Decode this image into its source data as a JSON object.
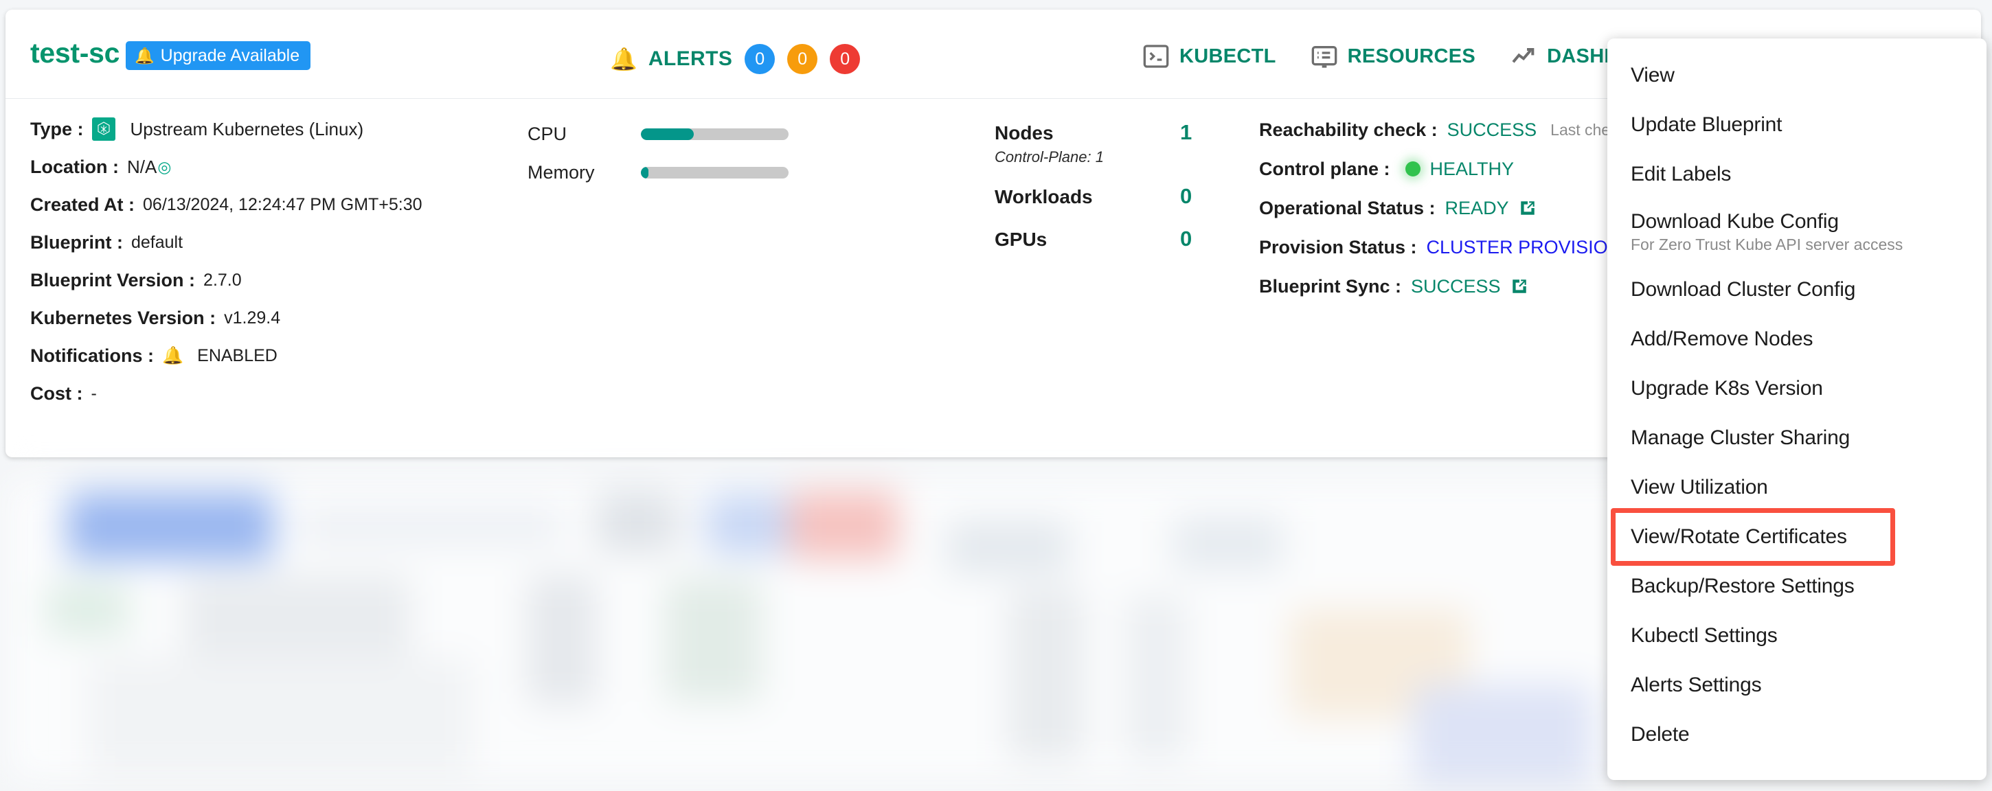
{
  "header": {
    "cluster_name": "test-sc",
    "upgrade_badge": {
      "label": "Upgrade Available",
      "icon": "bell-icon",
      "color": "#2196f3"
    },
    "alerts": {
      "label": "ALERTS",
      "icon": "alert-bell-icon",
      "counts": [
        {
          "value": "0",
          "severity": "info",
          "color": "#2196f3"
        },
        {
          "value": "0",
          "severity": "warning",
          "color": "#f79c0c"
        },
        {
          "value": "0",
          "severity": "critical",
          "color": "#ee3b33"
        }
      ]
    },
    "actions": [
      {
        "label": "KUBECTL",
        "icon": "terminal-icon"
      },
      {
        "label": "RESOURCES",
        "icon": "list-panel-icon"
      },
      {
        "label": "DASHBOARD",
        "icon": "trend-up-icon"
      }
    ],
    "kebab": "more-options-icon"
  },
  "details": {
    "type": {
      "label": "Type :",
      "value": "Upstream Kubernetes (Linux)",
      "icon": "kubernetes-icon"
    },
    "location": {
      "label": "Location :",
      "value": "N/A",
      "icon": "target-icon"
    },
    "created_at": {
      "label": "Created At :",
      "value": "06/13/2024, 12:24:47 PM GMT+5:30"
    },
    "blueprint": {
      "label": "Blueprint :",
      "value": "default"
    },
    "blueprint_version": {
      "label": "Blueprint Version :",
      "value": "2.7.0"
    },
    "kubernetes_version": {
      "label": "Kubernetes Version :",
      "value": "v1.29.4"
    },
    "notifications": {
      "label": "Notifications :",
      "value": "ENABLED",
      "icon": "bell-icon"
    },
    "cost": {
      "label": "Cost :",
      "value": "-"
    }
  },
  "resources": [
    {
      "label": "CPU",
      "percent": 36
    },
    {
      "label": "Memory",
      "percent": 5
    }
  ],
  "counts": {
    "nodes": {
      "label": "Nodes",
      "value": "1",
      "sub": "Control-Plane: 1"
    },
    "workloads": {
      "label": "Workloads",
      "value": "0"
    },
    "gpus": {
      "label": "GPUs",
      "value": "0"
    }
  },
  "status": {
    "reachability": {
      "label": "Reachability check :",
      "value": "SUCCESS",
      "note": "Last check-in"
    },
    "control_plane": {
      "label": "Control plane :",
      "value": "HEALTHY",
      "indicator": "green-dot"
    },
    "operational": {
      "label": "Operational Status :",
      "value": "READY",
      "icon": "external-link-icon"
    },
    "provision": {
      "label": "Provision Status :",
      "value": "CLUSTER PROVISION C"
    },
    "blueprint_sync": {
      "label": "Blueprint Sync :",
      "value": "SUCCESS",
      "icon": "external-link-icon"
    }
  },
  "menu": {
    "items": [
      {
        "label": "View"
      },
      {
        "label": "Update Blueprint"
      },
      {
        "label": "Edit Labels"
      },
      {
        "label": "Download Kube Config",
        "sub": "For Zero Trust Kube API server access"
      },
      {
        "label": "Download Cluster Config"
      },
      {
        "label": "Add/Remove Nodes"
      },
      {
        "label": "Upgrade K8s Version"
      },
      {
        "label": "Manage Cluster Sharing"
      },
      {
        "label": "View Utilization"
      },
      {
        "label": "View/Rotate Certificates",
        "highlighted": true
      },
      {
        "label": "Backup/Restore Settings"
      },
      {
        "label": "Kubectl Settings"
      },
      {
        "label": "Alerts Settings"
      },
      {
        "label": "Delete"
      }
    ],
    "highlight_color": "#f9503f"
  },
  "theme": {
    "accent_teal": "#07866a",
    "accent_blue": "#2196f3",
    "healthy_green": "#31c24d",
    "link_blue": "#1b1bf0"
  }
}
